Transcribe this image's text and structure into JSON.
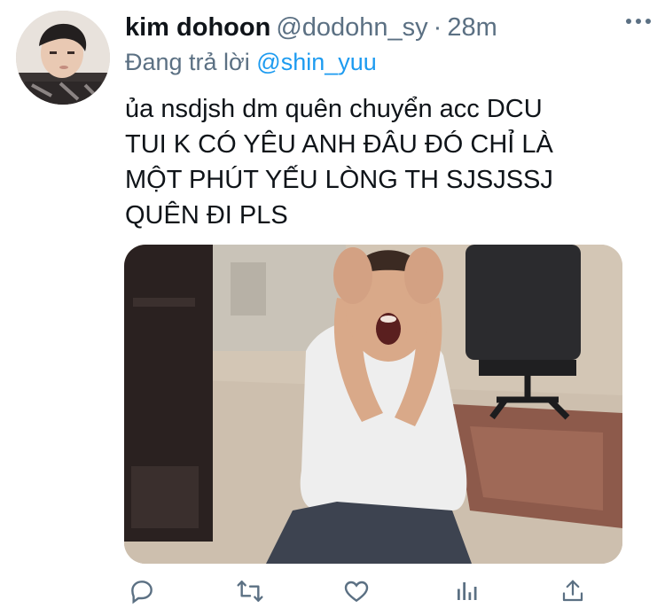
{
  "tweet": {
    "author_name": "kim dohoon",
    "author_handle": "@dodohn_sy",
    "separator": "·",
    "time": "28m",
    "reply_prefix": "Đang trả lời",
    "reply_to": "@shin_yuu",
    "text_lines": [
      "ủa nsdjsh dm quên chuyển acc DCU",
      "TUI K CÓ YÊU ANH ĐÂU ĐÓ CHỈ LÀ",
      "MỘT PHÚT YẾU LÒNG TH SJSJSSJ",
      "QUÊN ĐI PLS"
    ]
  },
  "icons": {
    "more": "more-icon",
    "reply": "reply-icon",
    "retweet": "retweet-icon",
    "like": "like-icon",
    "analytics": "analytics-icon",
    "share": "share-icon"
  },
  "colors": {
    "text": "#0f1419",
    "secondary": "#5b7083",
    "accent": "#1d9bf0"
  }
}
